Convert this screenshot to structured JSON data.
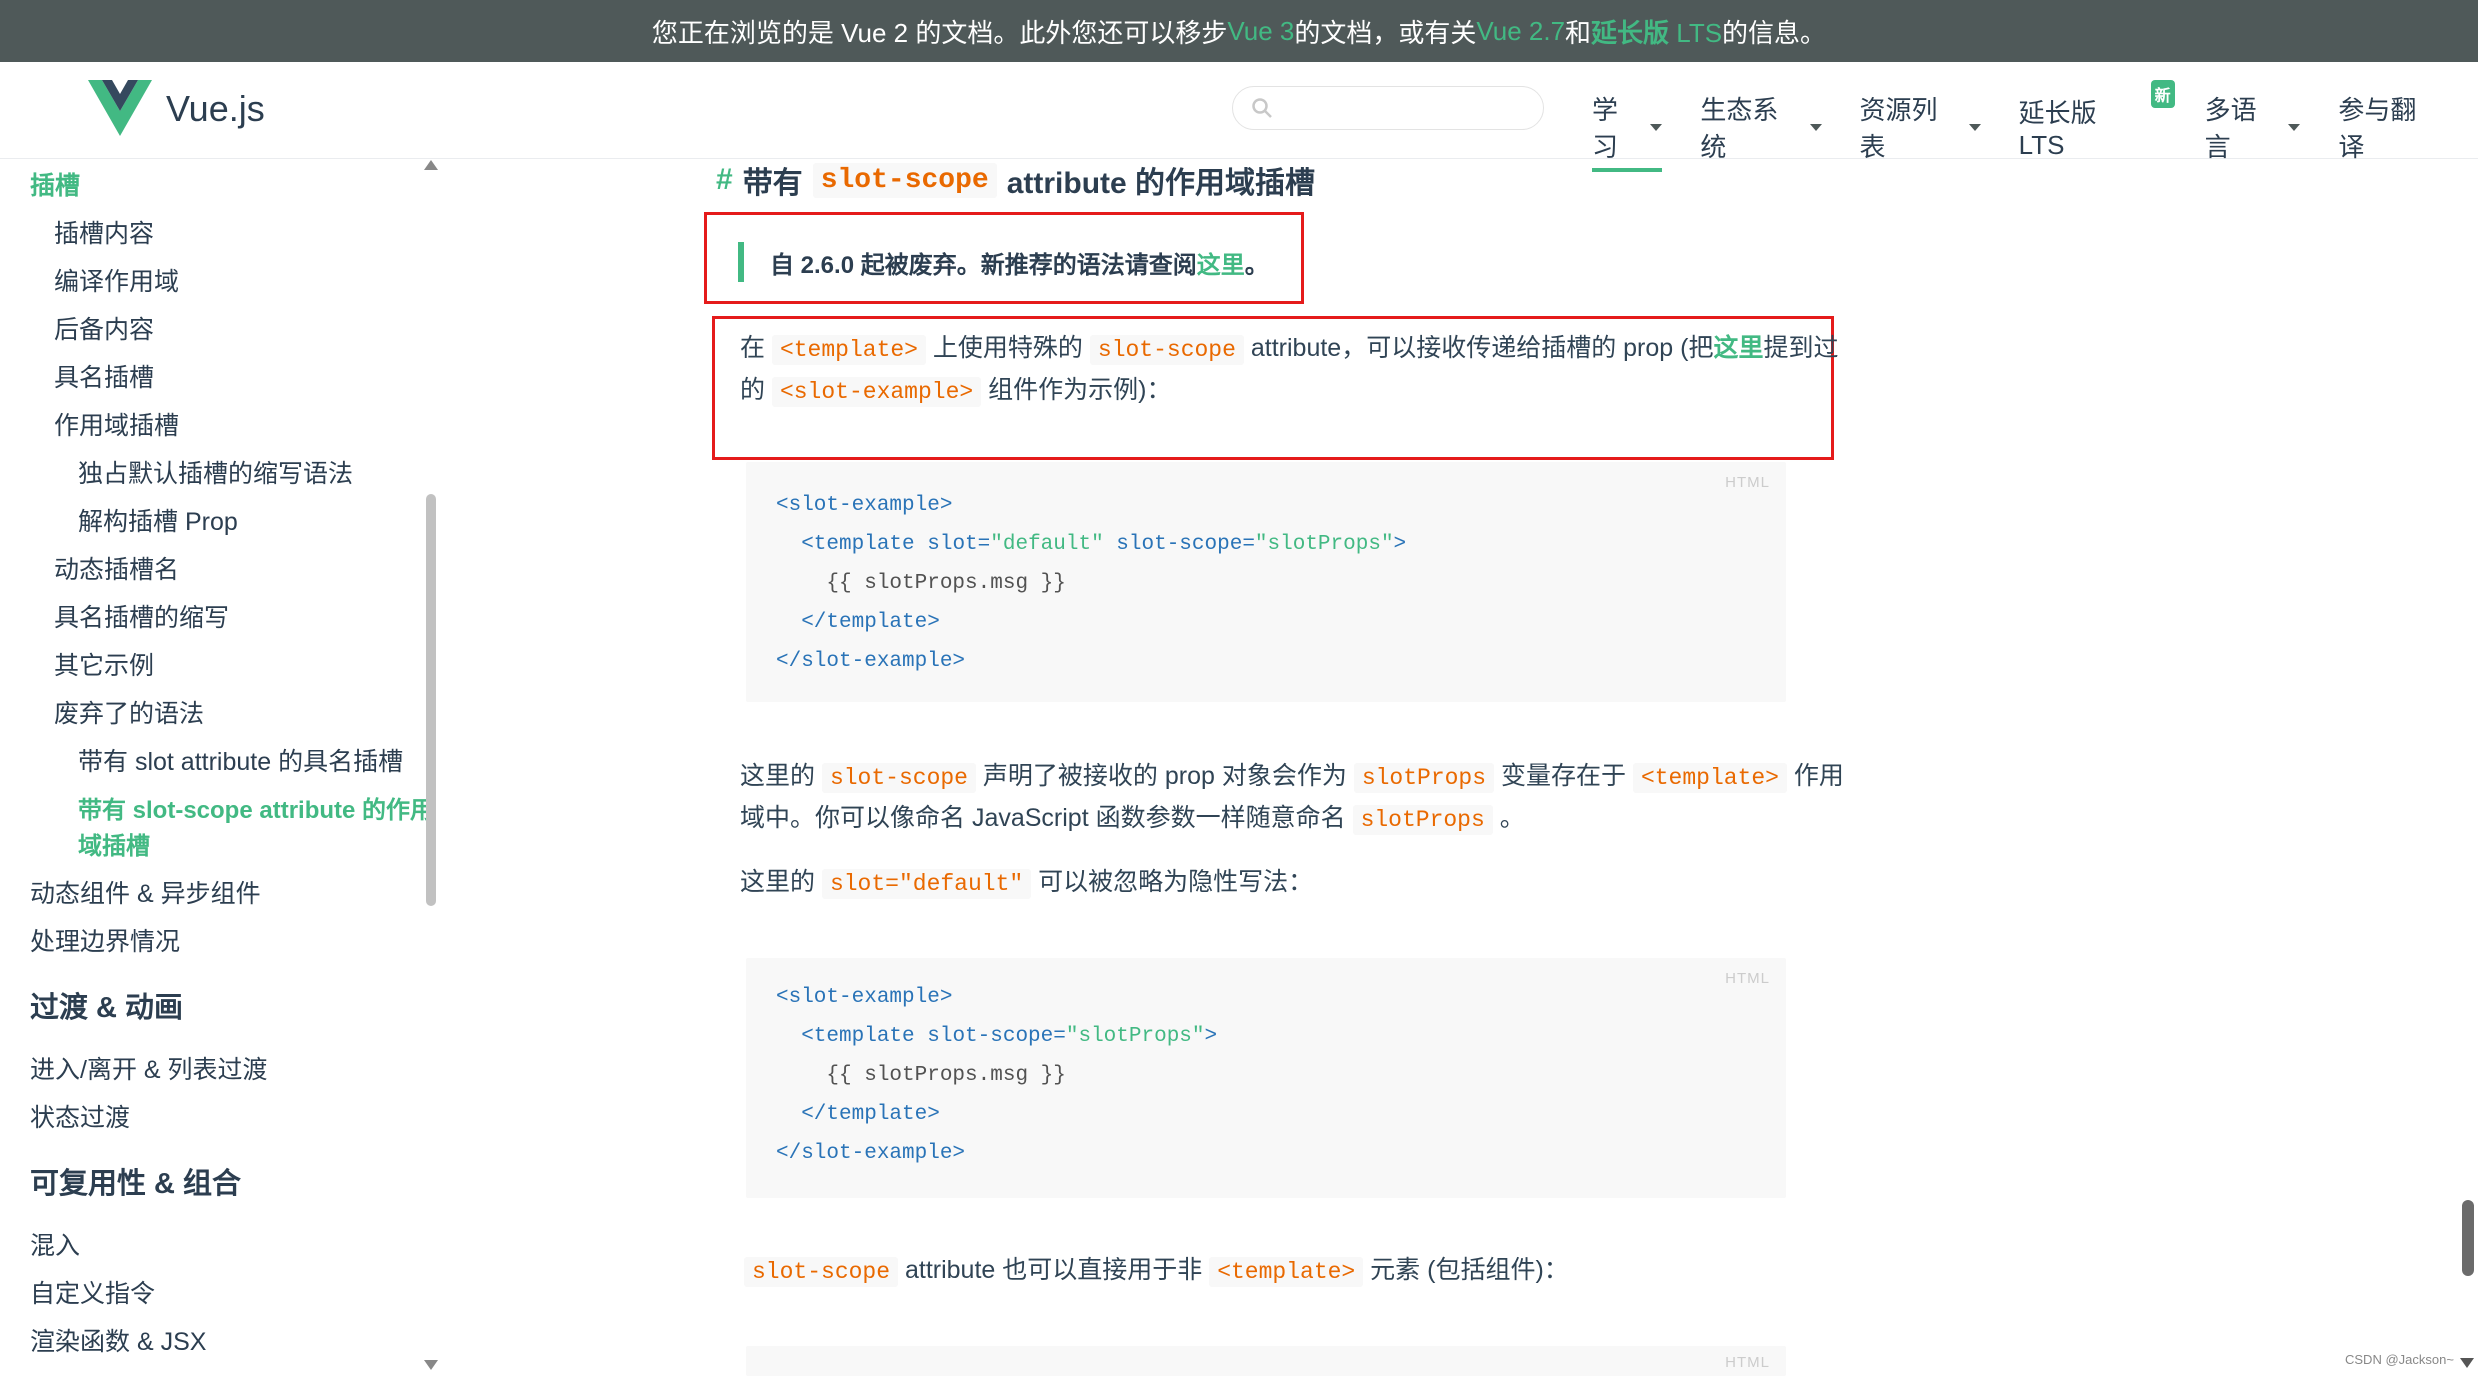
{
  "banner": {
    "part1": "您正在浏览的是 Vue 2 的文档。此外您还可以移步 ",
    "link1": "Vue 3",
    "part2": " 的文档，或有关 ",
    "link2": "Vue 2.7",
    "part3": " 和 ",
    "link3a": "延长版",
    "link3b": " LTS",
    "part4": " 的信息。"
  },
  "header": {
    "brand": "Vue.js",
    "search_placeholder": "",
    "nav": [
      {
        "label": "学习"
      },
      {
        "label": "生态系统"
      },
      {
        "label": "资源列表"
      },
      {
        "label": "延长版 LTS",
        "badge": "新"
      },
      {
        "label": "多语言"
      },
      {
        "label": "参与翻译"
      }
    ]
  },
  "sidebar": {
    "items": [
      "插槽",
      "插槽内容",
      "编译作用域",
      "后备内容",
      "具名插槽",
      "作用域插槽",
      "独占默认插槽的缩写语法",
      "解构插槽 Prop",
      "动态插槽名",
      "具名插槽的缩写",
      "其它示例",
      "废弃了的语法",
      "带有 slot attribute 的具名插槽",
      "带有 slot-scope attribute 的作用",
      "域插槽",
      "动态组件 & 异步组件",
      "处理边界情况"
    ],
    "heading_transitions": "过渡 & 动画",
    "transition_items": [
      "进入/离开 & 列表过渡",
      "状态过渡"
    ],
    "heading_reuse": "可复用性 & 组合",
    "reuse_items": [
      "混入",
      "自定义指令",
      "渲染函数 & JSX"
    ]
  },
  "content": {
    "section_hash": "#",
    "section_pre": "带有",
    "section_code": "slot-scope",
    "section_post": "attribute 的作用域插槽",
    "tip_text": "自 2.6.0 起被废弃。新推荐的语法请查阅",
    "tip_link": "这里",
    "tip_end": "。",
    "p1": {
      "a": "在 ",
      "c1": "<template>",
      "b": " 上使用特殊的 ",
      "c2": "slot-scope",
      "c": " attribute，可以接收传递给插槽的 prop (把",
      "link": "这里",
      "d": "提到过",
      "e": "的 ",
      "c3": "<slot-example>",
      "f": " 组件作为示例)："
    },
    "code1": {
      "lang": "HTML",
      "l1": "<slot-example>",
      "l2a": "  <template ",
      "l2b": "slot",
      "l2c": "=",
      "l2d": "\"default\"",
      "l2e": " slot-scope",
      "l2f": "=",
      "l2g": "\"slotProps\"",
      "l2h": ">",
      "l3": "    {{ slotProps.msg }}",
      "l4": "  </template>",
      "l5": "</slot-example>"
    },
    "p2": {
      "a": "这里的 ",
      "c1": "slot-scope",
      "b": " 声明了被接收的 prop 对象会作为 ",
      "c2": "slotProps",
      "c": " 变量存在于 ",
      "c3": "<template>",
      "d": " 作用",
      "e": "域中。你可以像命名 JavaScript 函数参数一样随意命名 ",
      "c4": "slotProps",
      "f": " 。"
    },
    "p3": {
      "a": "这里的 ",
      "c1": "slot=\"default\"",
      "b": " 可以被忽略为隐性写法："
    },
    "code2": {
      "lang": "HTML",
      "l1": "<slot-example>",
      "l2a": "  <template ",
      "l2b": "slot-scope",
      "l2c": "=",
      "l2d": "\"slotProps\"",
      "l2e": ">",
      "l3": "    {{ slotProps.msg }}",
      "l4": "  </template>",
      "l5": "</slot-example>"
    },
    "p4": {
      "c1": "slot-scope",
      "a": " attribute 也可以直接用于非 ",
      "c2": "<template>",
      "b": " 元素 (包括组件)："
    },
    "code3": {
      "lang": "HTML"
    }
  },
  "watermark": "CSDN @Jackson~",
  "colors": {
    "accent": "#42b983",
    "banner_bg": "#4f5959",
    "highlight_box": "#e51b1b",
    "inline_code": "#e96900"
  }
}
